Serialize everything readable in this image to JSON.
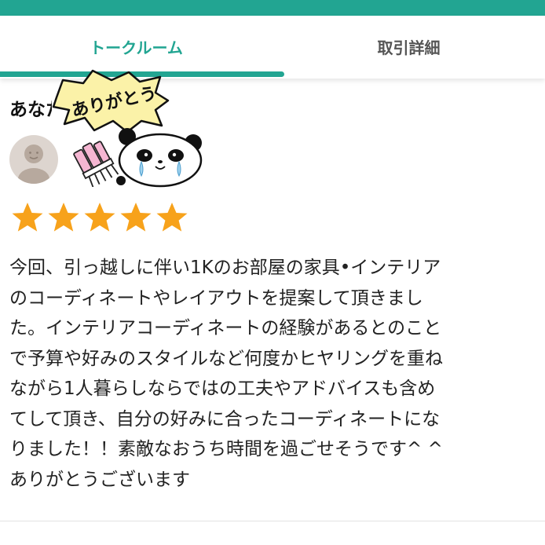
{
  "tabs": {
    "talk_room": "トークルーム",
    "transaction_details": "取引詳細"
  },
  "review": {
    "title": "あなたへの評価",
    "sticker_text": "ありがとう",
    "rating": 5,
    "rating_max": 5,
    "lines": [
      "今回、引っ越しに伴い1Kのお部屋の家具•インテリア",
      "のコーディネートやレイアウトを提案して頂きまし",
      "た。インテリアコーディネートの経験があるとのこと",
      "で予算や好みのスタイルなど何度かヒヤリングを重ね",
      "ながら1人暮らしならではの工夫やアドバイスも含め",
      "てして頂き、自分の好みに合ったコーディネートにな",
      "りました！！素敵なおうち時間を過ごせそうです^ ^",
      "ありがとうございます"
    ]
  },
  "colors": {
    "brand": "#22a592",
    "star": "#f7a21b",
    "avatar_bg": "#ddd5cf"
  },
  "icons": {
    "avatar": "user-avatar-icon",
    "brush": "makeup-brush-sticker",
    "panda": "crying-panda-sticker",
    "star": "star-icon"
  }
}
